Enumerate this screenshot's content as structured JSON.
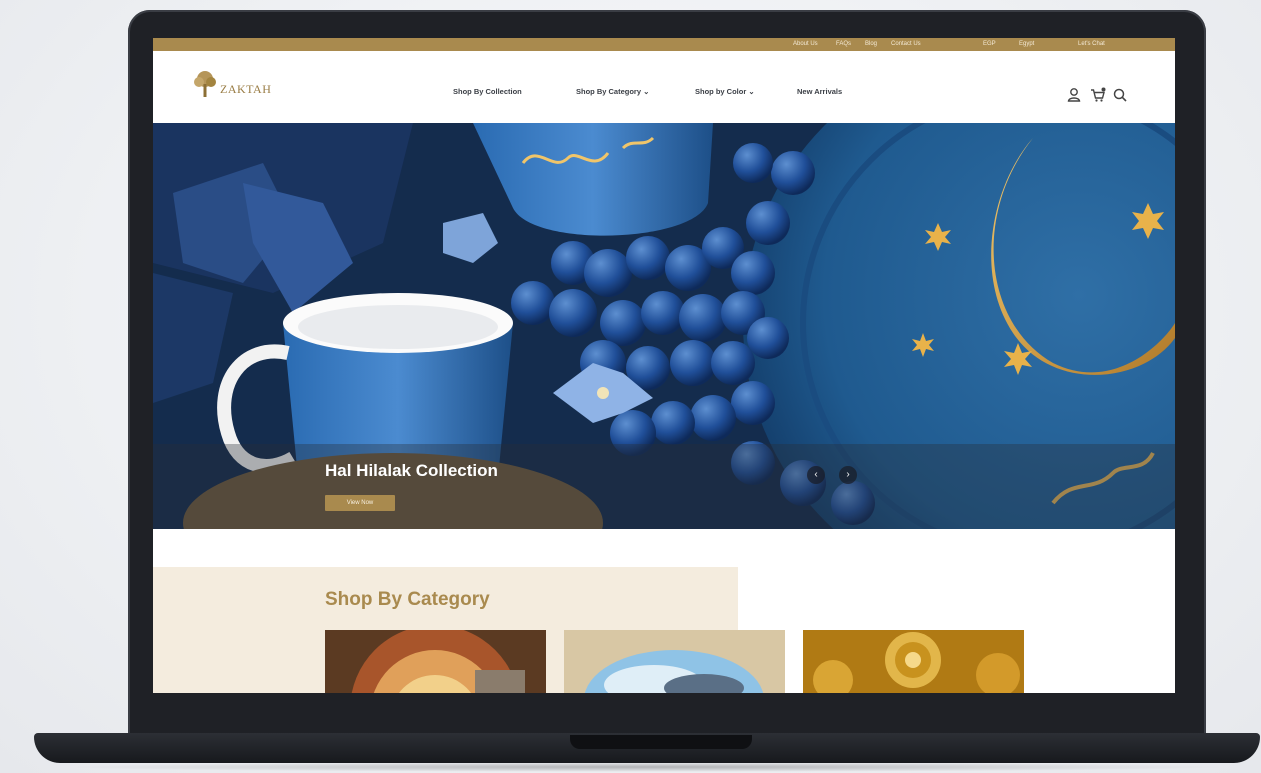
{
  "top_bar": {
    "links": [
      "About Us",
      "FAQs",
      "Blog",
      "Contact Us"
    ],
    "region": "Egypt",
    "currency": "EGP",
    "cart_label": "Let's Chat"
  },
  "header": {
    "logo_text": "ZAKTAH",
    "nav": [
      {
        "label": "Shop By Collection"
      },
      {
        "label": "Shop By Category ⌄"
      },
      {
        "label": "Shop by Color ⌄"
      },
      {
        "label": "New Arrivals"
      }
    ],
    "icons": [
      "user-icon",
      "cart-icon",
      "search-icon"
    ]
  },
  "hero": {
    "title": "Hal Hilalak Collection",
    "button_label": "View Now",
    "arrow_prev": "‹",
    "arrow_next": "›"
  },
  "category_section": {
    "title": "Shop By Category"
  },
  "colors": {
    "accent_gold": "#a98a4e",
    "navy": "#16304f",
    "category_bg": "#f4ecde"
  }
}
